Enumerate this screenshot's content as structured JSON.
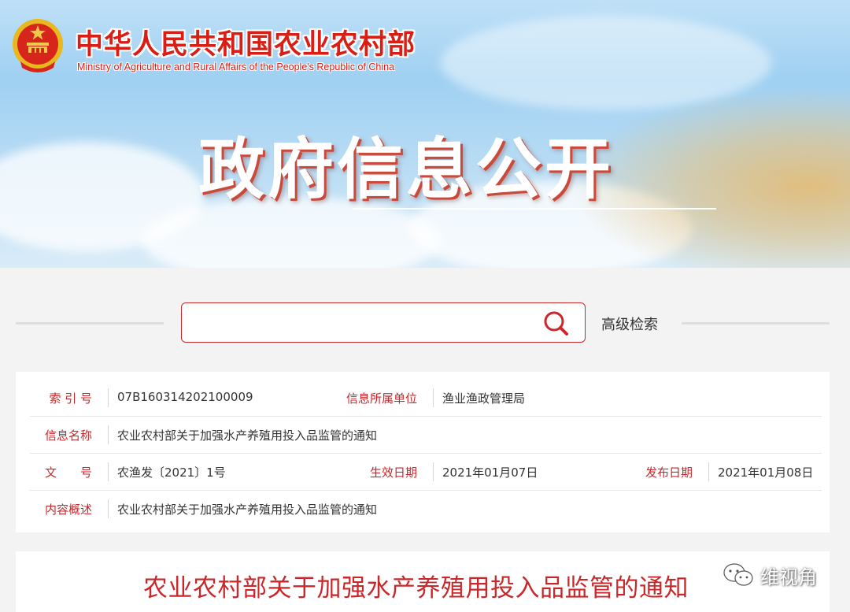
{
  "header": {
    "ministry_cn": "中华人民共和国农业农村部",
    "ministry_en": "Ministry of Agriculture and Rural Affairs of the People's Republic of China",
    "section_title": "政府信息公开"
  },
  "search": {
    "placeholder": "",
    "value": "",
    "advanced_label": "高级检索"
  },
  "info": {
    "index_no_label": "索 引 号",
    "index_no": "07B160314202100009",
    "unit_label": "信息所属单位",
    "unit": "渔业渔政管理局",
    "name_label": "信息名称",
    "name": "农业农村部关于加强水产养殖用投入品监管的通知",
    "doc_no_label": "文　　号",
    "doc_no": "农渔发〔2021〕1号",
    "effective_label": "生效日期",
    "effective_date": "2021年01月07日",
    "publish_label": "发布日期",
    "publish_date": "2021年01月08日",
    "summary_label": "内容概述",
    "summary": "农业农村部关于加强水产养殖用投入品监管的通知"
  },
  "article": {
    "title": "农业农村部关于加强水产养殖用投入品监管的通知"
  },
  "watermark": {
    "text": "维视角",
    "icon": "wechat-icon"
  },
  "colors": {
    "accent": "#c9272a",
    "label_red": "#c9272a",
    "banner_sky": "#9fd0f2"
  },
  "icons": {
    "emblem": "national-emblem-icon",
    "search": "search-icon"
  }
}
